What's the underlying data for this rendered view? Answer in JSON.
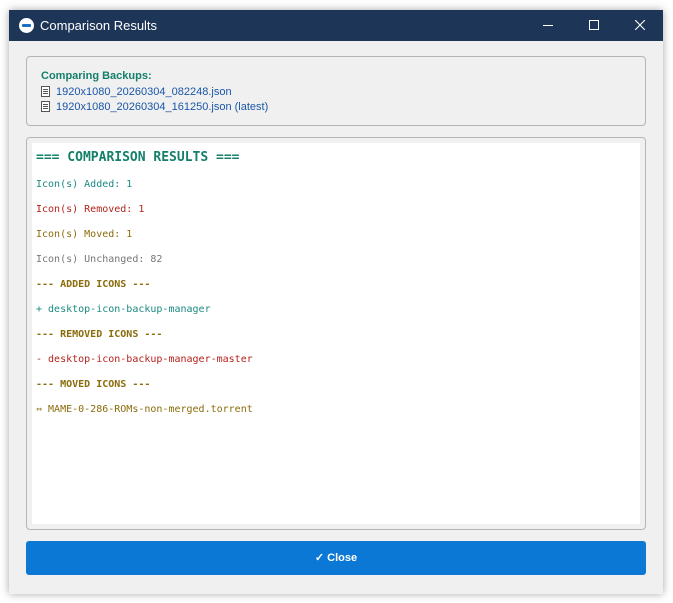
{
  "window": {
    "title": "Comparison Results"
  },
  "colors": {
    "titlebar": "#1d3557",
    "accent_green": "#14806a",
    "added": "#1a8a80",
    "removed": "#b5221b",
    "moved": "#8a6c0b",
    "unchanged": "#777777",
    "link": "#1a56a8",
    "close_button": "#0a78d4"
  },
  "comparing": {
    "heading": "Comparing Backups:",
    "files": [
      {
        "icon": "document-icon",
        "name": "1920x1080_20260304_082248.json"
      },
      {
        "icon": "document-icon",
        "name": "1920x1080_20260304_161250.json (latest)"
      }
    ]
  },
  "results": {
    "title": "=== COMPARISON RESULTS ===",
    "added_summary": "Icon(s) Added: 1",
    "removed_summary": "Icon(s) Removed: 1",
    "moved_summary": "Icon(s) Moved: 1",
    "unchanged_summary": "Icon(s) Unchanged: 82",
    "added_header": "--- ADDED ICONS ---",
    "added_items": [
      "+ desktop-icon-backup-manager"
    ],
    "removed_header": "--- REMOVED ICONS ---",
    "removed_items": [
      "- desktop-icon-backup-manager-master"
    ],
    "moved_header": "--- MOVED ICONS ---",
    "moved_items": [
      "⇔ MAME-0-286-ROMs-non-merged.torrent"
    ]
  },
  "footer": {
    "close_label": "✓ Close"
  }
}
